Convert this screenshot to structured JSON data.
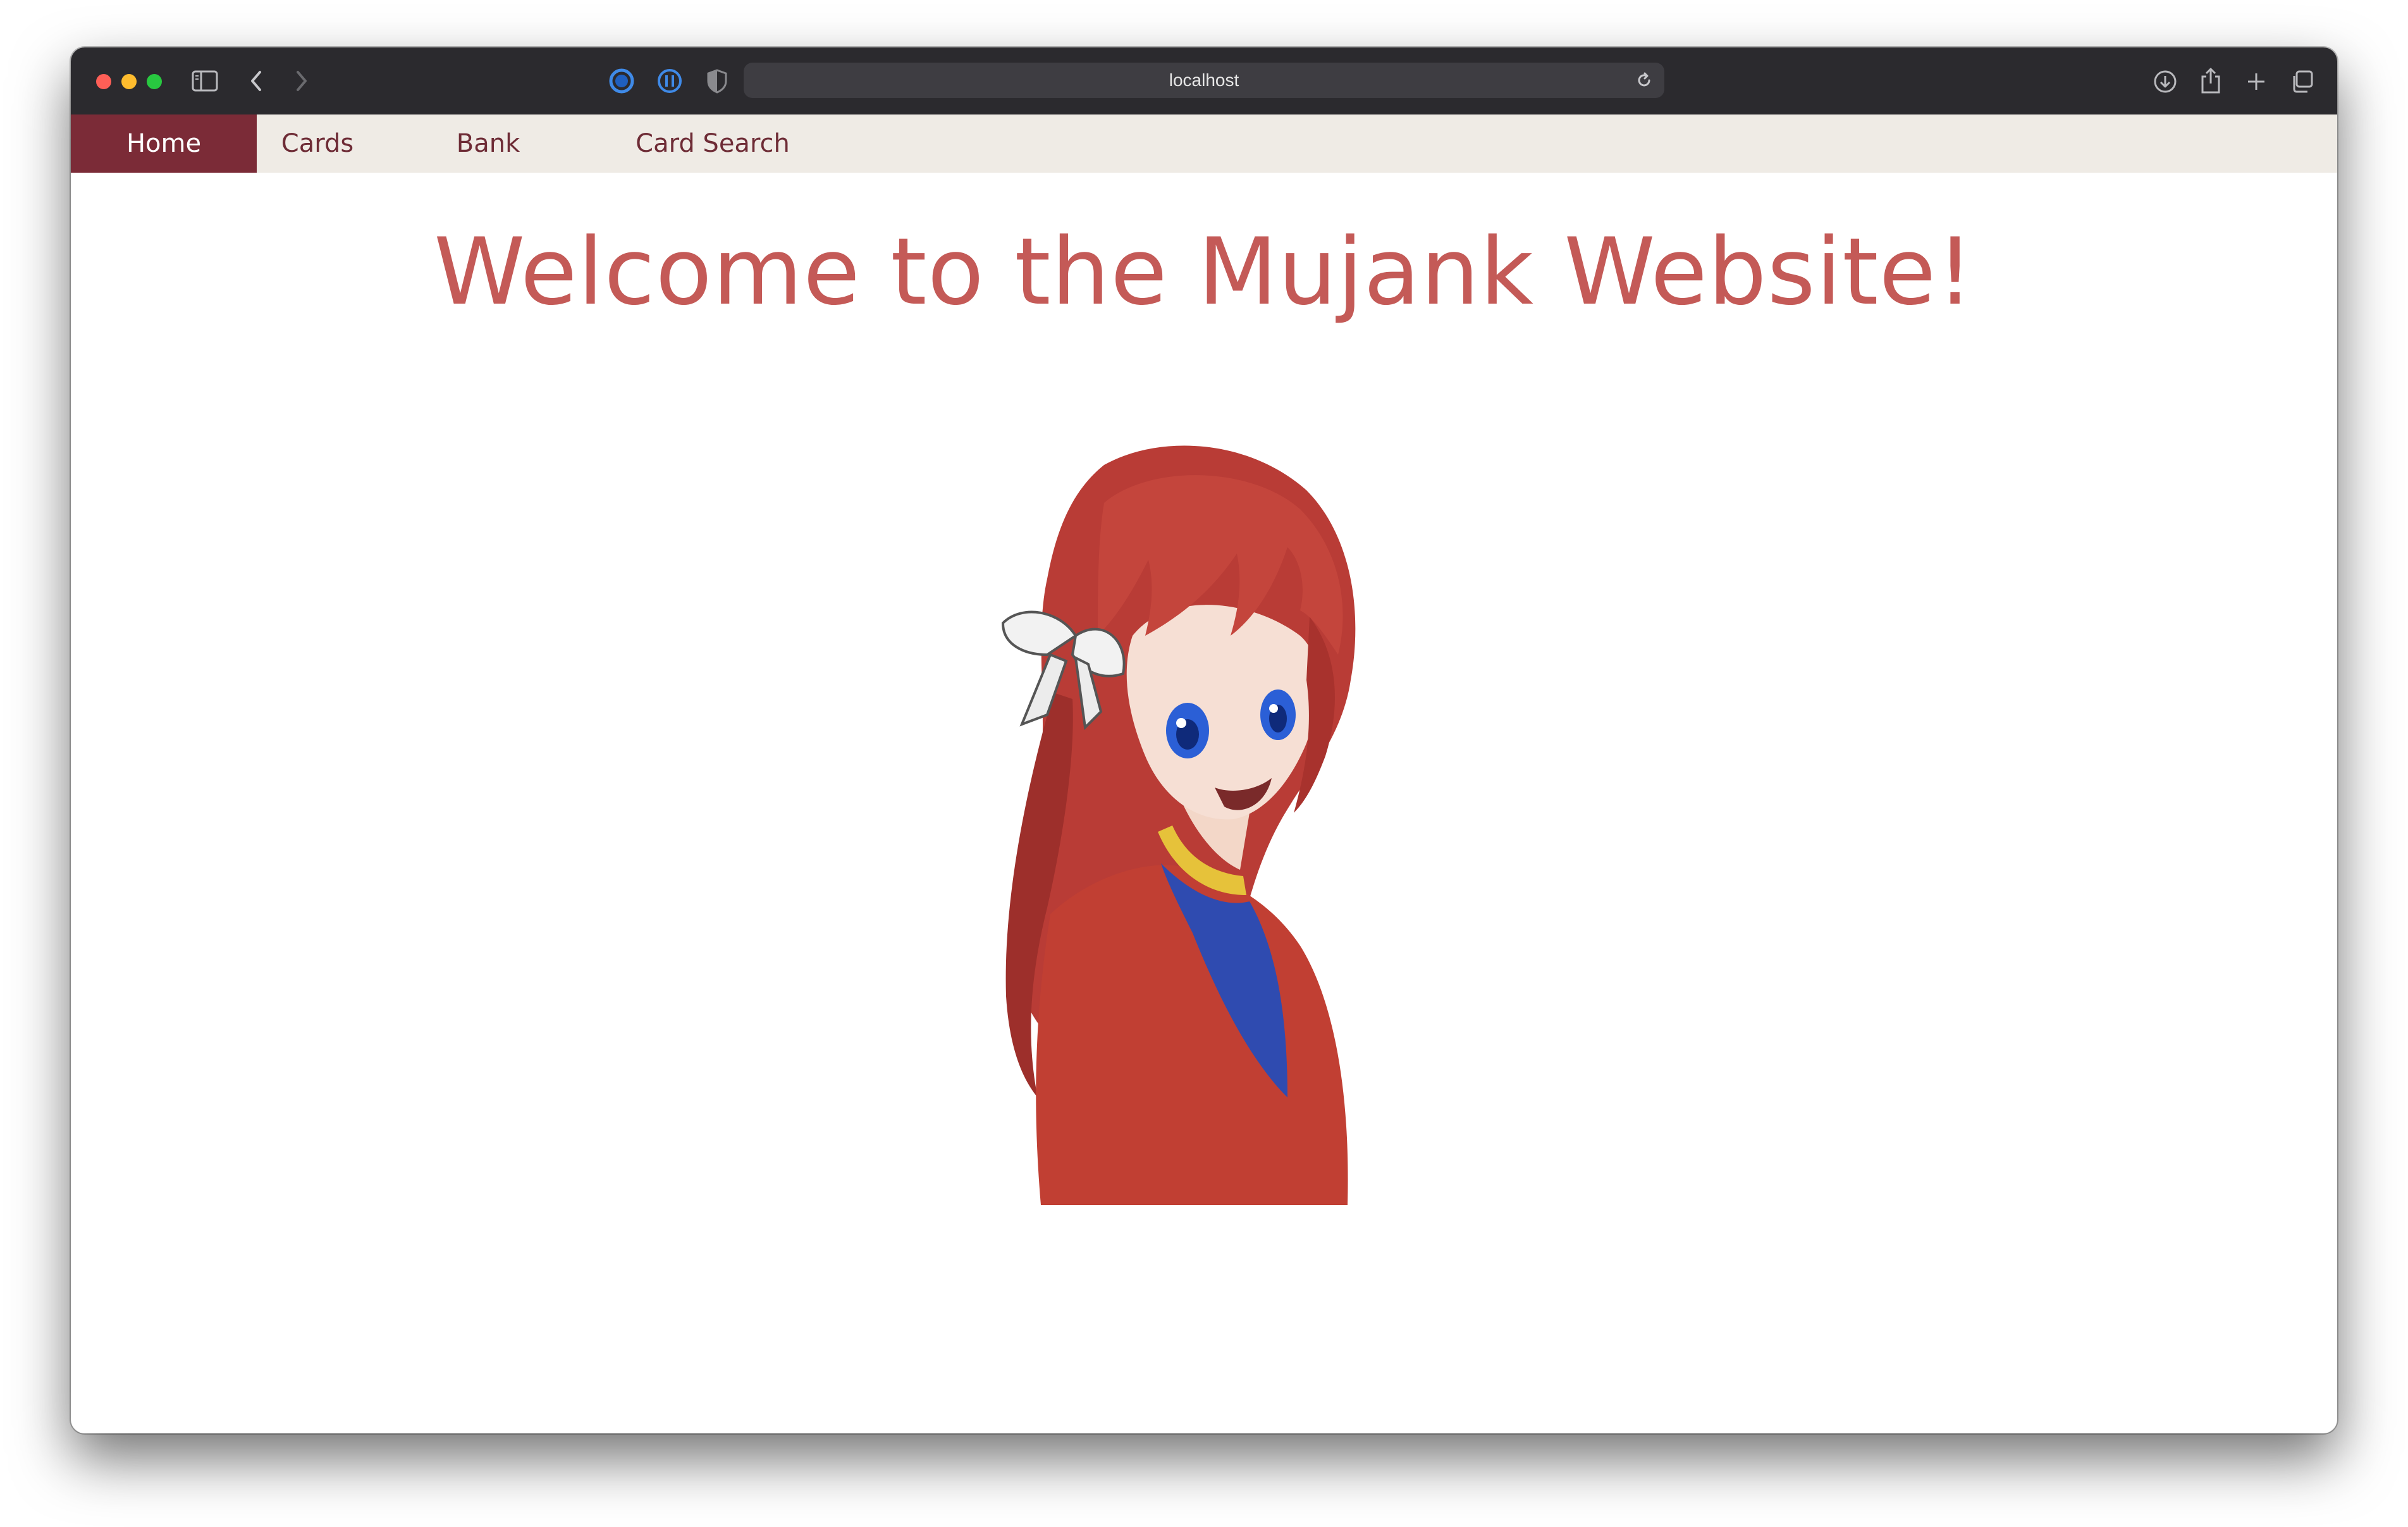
{
  "browser": {
    "url": "localhost"
  },
  "nav": {
    "items": [
      {
        "label": "Home",
        "active": true
      },
      {
        "label": "Cards",
        "active": false
      },
      {
        "label": "Bank",
        "active": false
      },
      {
        "label": "Card Search",
        "active": false
      }
    ]
  },
  "main": {
    "heading": "Welcome to the Mujank Website!"
  },
  "colors": {
    "nav_active_bg": "#7b2b37",
    "nav_bg": "#efebe5",
    "nav_text": "#6e2c36",
    "heading": "#c45a57"
  }
}
